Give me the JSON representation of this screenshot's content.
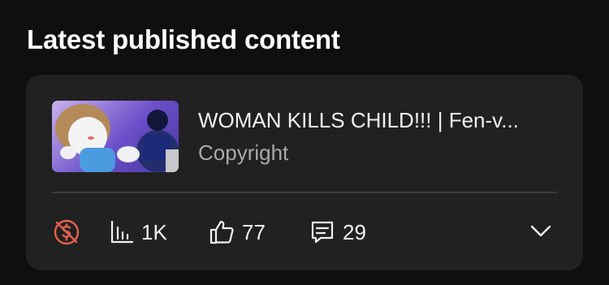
{
  "section": {
    "title": "Latest published content"
  },
  "video": {
    "title": "WOMAN KILLS CHILD!!! | Fen-v...",
    "status": "Copyright",
    "views": "1K",
    "likes": "77",
    "comments": "29"
  },
  "icons": {
    "monetization": "monetization-off-icon",
    "views": "bar-chart-icon",
    "likes": "thumbs-up-icon",
    "comments": "comment-icon",
    "expand": "chevron-down-icon"
  },
  "colors": {
    "background": "#0f0f0f",
    "card": "#212121",
    "monetization_off": "#e8604c",
    "secondary_text": "#aaaaaa"
  }
}
